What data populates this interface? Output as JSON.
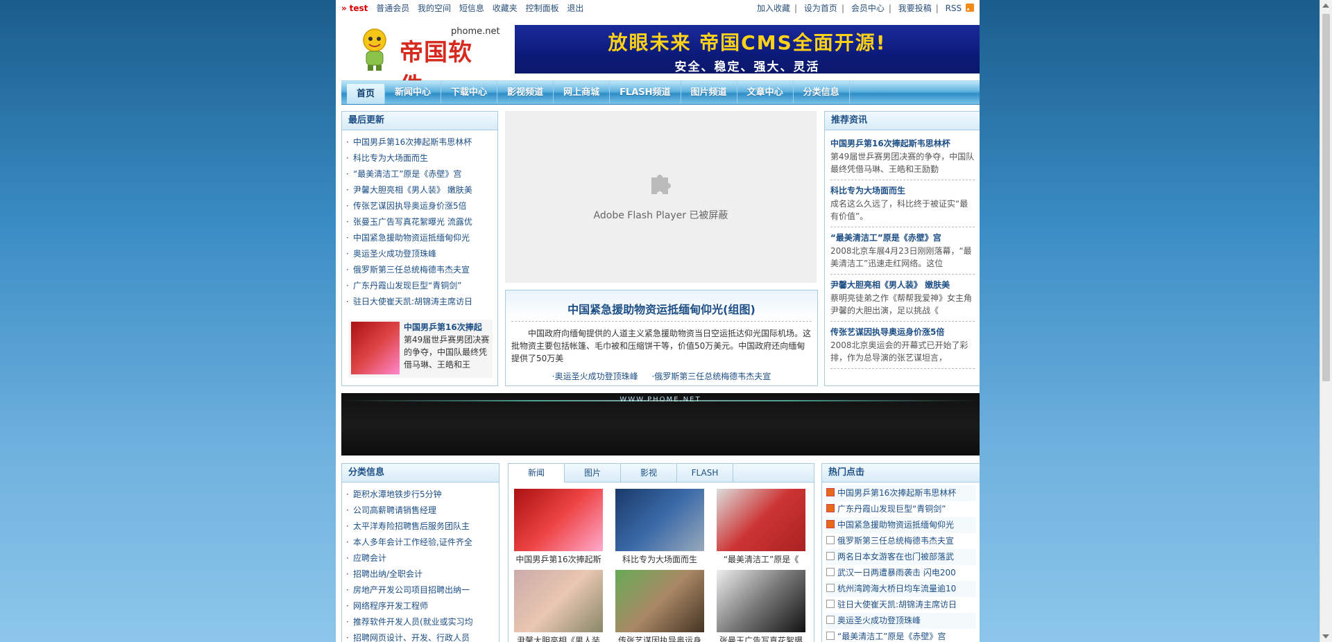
{
  "topbar": {
    "arrow": "»",
    "user": "test",
    "links": [
      "普通会员",
      "我的空间",
      "短信息",
      "收藏夹",
      "控制面板",
      "退出"
    ],
    "right": [
      "加入收藏",
      "设为首页",
      "会员中心",
      "我要投稿",
      "RSS"
    ]
  },
  "logo": {
    "domain": "phome.net",
    "name": "帝国软件"
  },
  "banner": {
    "line1": "放眼未来 帝国CMS全面开源!",
    "line2": "安全、稳定、强大、灵活"
  },
  "nav": [
    "首页",
    "新闻中心",
    "下载中心",
    "影视频道",
    "网上商城",
    "FLASH频道",
    "图片频道",
    "文章中心",
    "分类信息"
  ],
  "latest": {
    "title": "最后更新",
    "items": [
      "中国男乒第16次捧起斯韦思林杯",
      "科比专为大场面而生",
      "“最美清洁工”原是《赤壁》宫",
      "尹馨大胆亮相《男人装》 嫩肤美",
      "传张艺谋因执导奥运身价涨5倍",
      "张曼玉广告写真花絮曝光 流露优",
      "中国紧急援助物资运抵缅甸仰光",
      "奥运圣火成功登顶珠峰",
      "俄罗斯第三任总统梅德韦杰夫宣",
      "广东丹霞山发现巨型“青铜剑”",
      "驻日大使崔天凯:胡锦涛主席访日"
    ],
    "pic": {
      "title": "中国男乒第16次捧起",
      "desc": "第49届世乒赛男团决赛的争夺，中国队最终凭借马琳、王皓和王"
    }
  },
  "flash": {
    "text": "Adobe Flash Player 已被屏蔽"
  },
  "headline": {
    "title": "中国紧急援助物资运抵缅甸仰光(组图)",
    "desc": "中国政府向缅甸提供的人道主义紧急援助物资当日空运抵达仰光国际机场。这批物资主要包括帐篷、毛巾被和压缩饼干等，价值50万美元。中国政府还向缅甸提供了50万美",
    "links": [
      "·奥运圣火成功登顶珠峰",
      "·俄罗斯第三任总统梅德韦杰夫宣"
    ]
  },
  "recommend": {
    "title": "推荐资讯",
    "items": [
      {
        "title": "中国男乒第16次捧起斯韦思林杯",
        "desc": "第49届世乒赛男团决赛的争夺，中国队最终凭借马琳、王皓和王励勤"
      },
      {
        "title": "科比专为大场面而生",
        "desc": "成名这么久远了，科比终于被证实“最有价值”。"
      },
      {
        "title": "“最美清洁工”原是《赤壁》宫",
        "desc": "2008北京车展4月23日刚刚落幕，“最美清洁工”迅速走红网络。这位"
      },
      {
        "title": "尹馨大胆亮相《男人装》 嫩肤美",
        "desc": "蔡明亮徒弟之作《帮帮我爱神》女主角尹馨的大胆出演，足以挑战《"
      },
      {
        "title": "传张艺谋因执导奥运身价涨5倍",
        "desc": "2008北京奥运会的开幕式已开始了彩排，作为总导演的张艺谋坦言，"
      }
    ]
  },
  "darkbar": {
    "label": "WWW.PHOME.NET"
  },
  "category": {
    "title": "分类信息",
    "items": [
      "距积水潭地铁步行5分钟",
      "公司高薪聘请销售经理",
      "太平洋寿险招聘售后服务团队主",
      "本人多年会计工作经验,证件齐全",
      "应聘会计",
      "招聘出纳/全职会计",
      "房地产开发公司项目招聘出纳一",
      "网络程序开发工程师",
      "推荐软件开发人员(就业或实习均",
      "招聘网页设计、开发、行政人员"
    ]
  },
  "tabs": {
    "labels": [
      "新闻",
      "图片",
      "影视",
      "FLASH"
    ],
    "grid": [
      "中国男乒第16次捧起斯",
      "科比专为大场面而生",
      "“最美清洁工”原是《",
      "尹馨大胆亮相《男人装",
      "传张艺谋因执导奥运身",
      "张曼玉广告写真花絮曝"
    ]
  },
  "hot": {
    "title": "热门点击",
    "items": [
      "中国男乒第16次捧起斯韦思林杯",
      "广东丹霞山发现巨型“青铜剑”",
      "中国紧急援助物资运抵缅甸仰光",
      "俄罗斯第三任总统梅德韦杰夫宣",
      "两名日本女游客在也门被部落武",
      "武汉一日两遭暴雨袭击 闪电200",
      "杭州湾跨海大桥日均车流量逾10",
      "驻日大使崔天凯:胡锦涛主席访日",
      "奥运圣火成功登顶珠峰",
      "“最美清洁工”原是《赤壁》宫"
    ]
  }
}
